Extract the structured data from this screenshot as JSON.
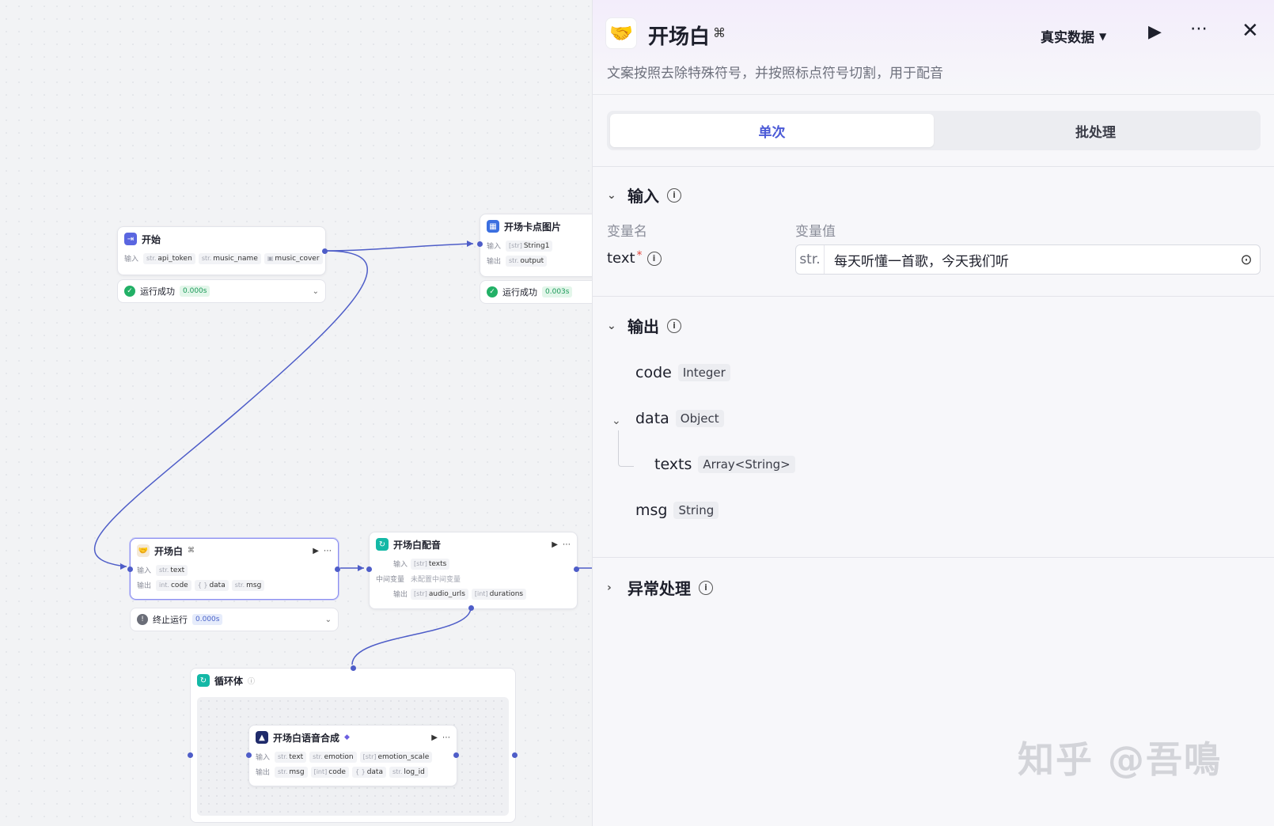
{
  "canvas": {
    "start": {
      "title": "开始",
      "label_input": "输入",
      "params": [
        {
          "t": "str.",
          "name": "api_token"
        },
        {
          "t": "str.",
          "name": "music_name"
        },
        {
          "t": "▣",
          "name": "music_cover"
        }
      ],
      "status_text": "运行成功",
      "status_time": "0.000s"
    },
    "card": {
      "title": "开场卡点图片",
      "label_input": "输入",
      "label_output": "输出",
      "input": {
        "t": "[str]",
        "name": "String1"
      },
      "output": {
        "t": "str.",
        "name": "output"
      },
      "status_text": "运行成功",
      "status_time": "0.003s"
    },
    "opening": {
      "title": "开场白",
      "label_input": "输入",
      "label_output": "输出",
      "input": {
        "t": "str.",
        "name": "text"
      },
      "outputs": [
        {
          "t": "int.",
          "name": "code"
        },
        {
          "t": "{ }",
          "name": "data"
        },
        {
          "t": "str.",
          "name": "msg"
        }
      ],
      "status_text": "终止运行",
      "status_time": "0.000s"
    },
    "dub": {
      "title": "开场白配音",
      "label_input": "输入",
      "label_mid": "中间变量",
      "label_output": "输出",
      "input": {
        "t": "[str]",
        "name": "texts"
      },
      "mid_value": "未配置中间变量",
      "outputs": [
        {
          "t": "[str]",
          "name": "audio_urls"
        },
        {
          "t": "[int]",
          "name": "durations"
        }
      ]
    },
    "loop": {
      "title": "循环体"
    },
    "tts": {
      "title": "开场白语音合成",
      "label_input": "输入",
      "label_output": "输出",
      "inputs": [
        {
          "t": "str.",
          "name": "text"
        },
        {
          "t": "str.",
          "name": "emotion"
        },
        {
          "t": "[str]",
          "name": "emotion_scale"
        }
      ],
      "outputs": [
        {
          "t": "str.",
          "name": "msg"
        },
        {
          "t": "[int]",
          "name": "code"
        },
        {
          "t": "{ }",
          "name": "data"
        },
        {
          "t": "str.",
          "name": "log_id"
        }
      ]
    }
  },
  "panel": {
    "title": "开场白",
    "description": "文案按照去除特殊符号，并按照标点符号切割，用于配音",
    "real_data_label": "真实数据",
    "tabs": [
      "单次",
      "批处理"
    ],
    "input_section": {
      "title": "输入",
      "col_name": "变量名",
      "col_value": "变量值",
      "var_name": "text",
      "required_mark": "*",
      "var_type": "str.",
      "var_value": "每天听懂一首歌，今天我们听"
    },
    "output_section": {
      "title": "输出",
      "fields": [
        {
          "name": "code",
          "type": "Integer"
        },
        {
          "name": "data",
          "type": "Object"
        },
        {
          "name": "texts",
          "type": "Array<String>"
        },
        {
          "name": "msg",
          "type": "String"
        }
      ]
    },
    "error_section": {
      "title": "异常处理"
    }
  },
  "watermark": "知乎 @吾鳴",
  "colors": {
    "accent": "#4a59d6",
    "edge": "#4e5dc8",
    "success": "#22b066"
  }
}
